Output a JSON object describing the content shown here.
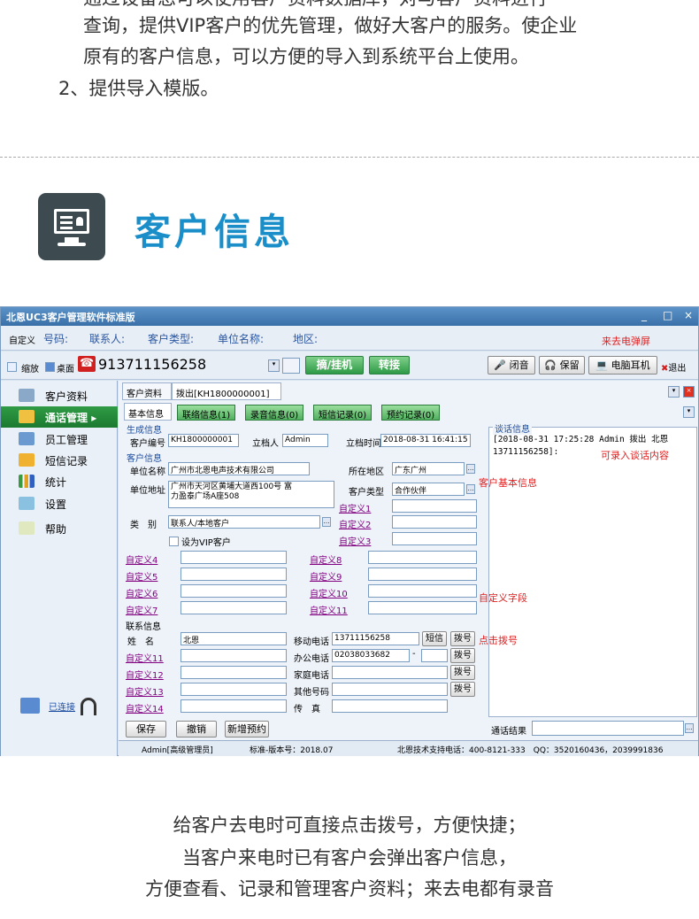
{
  "intro": {
    "line0": "通过设备您可以使用客户资料数据库，对与客户资料进行",
    "line1": "查询，提供VIP客户的优先管理，做好大客户的服务。使企业",
    "line2": "原有的客户信息，可以方便的导入到系统平台上使用。",
    "line3": "2、提供导入模版。"
  },
  "section": {
    "title": "客户信息"
  },
  "window": {
    "title": "北恩UC3客户管理软件标准版",
    "controls": {
      "min": "_",
      "max": "□",
      "close": "×"
    },
    "row1": {
      "custom": "自定义",
      "fields": [
        "号码:",
        "联系人:",
        "客户类型:",
        "单位名称:",
        "地区:"
      ],
      "incoming": "来去电弹屏"
    },
    "row2": {
      "zoom": "缩放",
      "desktop": "桌面",
      "phone": "913711156258",
      "answer": "摘/挂机",
      "transfer": "转接",
      "mute": "闭音",
      "hold": "保留",
      "headset": "电脑耳机",
      "exit": "退出"
    },
    "sidebar": {
      "items": [
        "客户资料",
        "通话管理",
        "员工管理",
        "短信记录",
        "统计",
        "设置",
        "帮助"
      ],
      "connected": "已连接"
    },
    "doc_tabs": [
      "客户资料",
      "拨出[KH1800000001]"
    ],
    "sub_tabs": [
      "基本信息",
      "联络信息(1)",
      "录音信息(0)",
      "短信记录(0)",
      "预约记录(0)"
    ],
    "gen": {
      "heading": "生成信息",
      "code_label": "客户编号",
      "code": "KH1800000001",
      "creator_label": "立档人",
      "creator": "Admin",
      "time_label": "立档时间",
      "time": "2018-08-31 16:41:15"
    },
    "cust": {
      "heading": "客户信息",
      "unit_label": "单位名称",
      "unit": "广州市北恩电声技术有限公司",
      "region_label": "所在地区",
      "region": "广东广州",
      "addr_label": "单位地址",
      "addr1": "广州市天河区黄埔大道西100号 富",
      "addr2": "力盈泰广场A座508",
      "type_label": "客户类型",
      "type": "合作伙伴",
      "cat_label": "类　别",
      "cat": "联系人/本地客户",
      "vip": "设为VIP客户",
      "c1": "自定义1",
      "c2": "自定义2",
      "c3": "自定义3",
      "c4": "自定义4",
      "c5": "自定义5",
      "c6": "自定义6",
      "c7": "自定义7",
      "c8": "自定义8",
      "c9": "自定义9",
      "c10": "自定义10",
      "c11": "自定义11"
    },
    "contact": {
      "heading": "联系信息",
      "name_label": "姓　名",
      "name": "北恩",
      "mobile_label": "移动电话",
      "mobile": "13711156258",
      "sms": "短信",
      "dial": "拨号",
      "office_label": "办公电话",
      "office": "02038033682",
      "dash": "-",
      "home_label": "家庭电话",
      "other_label": "其他号码",
      "fax_label": "传　真",
      "c11": "自定义11",
      "c12": "自定义12",
      "c13": "自定义13",
      "c14": "自定义14"
    },
    "talk": {
      "heading": "谈话信息",
      "log": "[2018-08-31 17:25:28 Admin 拨出 北恩 13711156258]:",
      "note": "可录入谈话内容",
      "result_label": "通话结果"
    },
    "notes": {
      "basic": "客户基本信息",
      "custom": "自定义字段",
      "dial": "点击拨号"
    },
    "buttons": {
      "save": "保存",
      "cancel": "撤销",
      "appt": "新增预约"
    },
    "status": {
      "user": "Admin[高级管理员]",
      "version": "标准-版本号：2018.07",
      "support": "北恩技术支持电话：400-8121-333　QQ：3520160436，2039991836"
    }
  },
  "caption": {
    "line1": "给客户去电时可直接点击拨号，方便快捷；",
    "line2": "当客户来电时已有客户会弹出客户信息，",
    "line3": "方便查看、记录和管理客户资料；来去电都有录音"
  },
  "colors": {
    "accent": "#1a8ec8",
    "green": "#2e9a46",
    "red": "#e02020",
    "purple": "#800080"
  }
}
